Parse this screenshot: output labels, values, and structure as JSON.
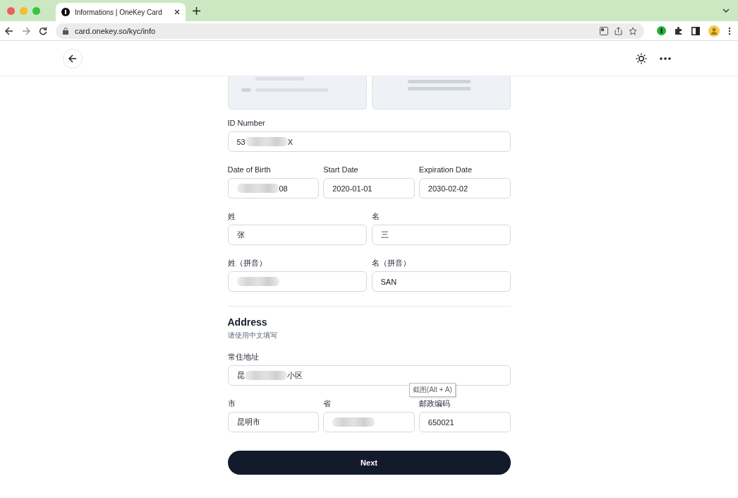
{
  "browser": {
    "tab_title": "Informations | OneKey Card",
    "url": "card.onekey.so/kyc/info"
  },
  "id_number": {
    "label": "ID Number",
    "value": [
      {
        "kind": "text",
        "text": "53"
      },
      {
        "kind": "blur"
      },
      {
        "kind": "text",
        "text": "X"
      }
    ]
  },
  "dates": [
    {
      "label": "Date of Birth",
      "value": [
        {
          "kind": "blur"
        },
        {
          "kind": "text",
          "text": "08"
        }
      ]
    },
    {
      "label": "Start Date",
      "value": [
        {
          "kind": "text",
          "text": "2020-01-01"
        }
      ]
    },
    {
      "label": "Expiration Date",
      "value": [
        {
          "kind": "text",
          "text": "2030-02-02"
        }
      ]
    }
  ],
  "names": [
    {
      "label": "姓",
      "value": [
        {
          "kind": "text",
          "text": "张"
        }
      ]
    },
    {
      "label": "名",
      "value": [
        {
          "kind": "text",
          "text": "三"
        }
      ]
    },
    {
      "label": "姓（拼音）",
      "value": [
        {
          "kind": "blur"
        }
      ]
    },
    {
      "label": "名（拼音）",
      "value": [
        {
          "kind": "text",
          "text": "SAN"
        }
      ]
    }
  ],
  "address": {
    "title": "Address",
    "hint": "请使用中文填写",
    "street": {
      "label": "常住地址",
      "value": [
        {
          "kind": "text",
          "text": "昆"
        },
        {
          "kind": "blur"
        },
        {
          "kind": "text",
          "text": "小区"
        }
      ]
    },
    "fields": [
      {
        "label": "市",
        "value": [
          {
            "kind": "text",
            "text": "昆明市"
          }
        ]
      },
      {
        "label": "省",
        "value": [
          {
            "kind": "blur"
          }
        ]
      },
      {
        "label": "邮政编码",
        "value": [
          {
            "kind": "text",
            "text": "650021"
          }
        ]
      }
    ],
    "tooltip": "截图(Alt + A)"
  },
  "next_button": "Next"
}
